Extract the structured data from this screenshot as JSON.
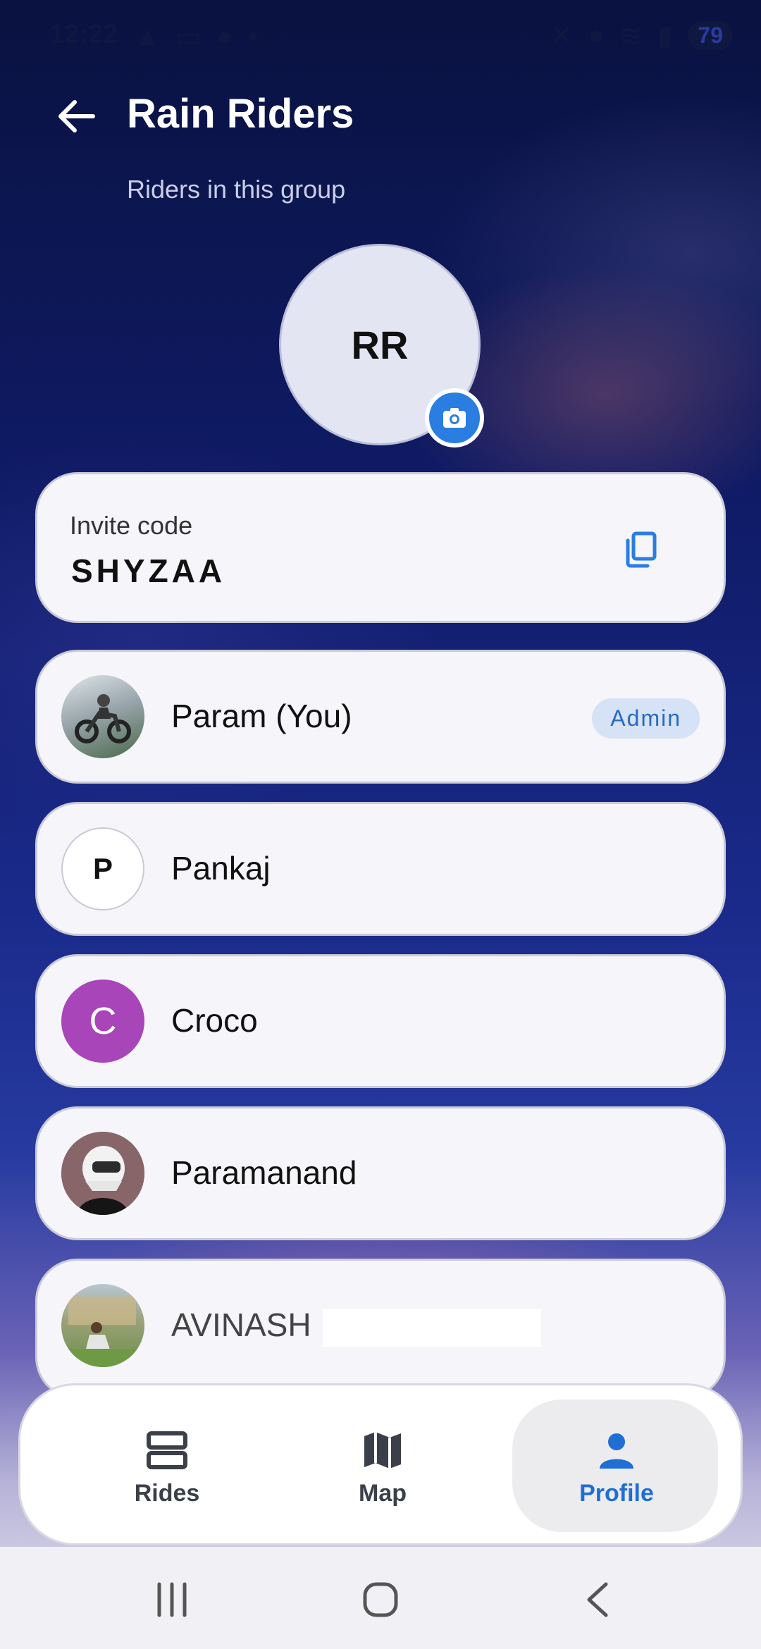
{
  "status_bar": {
    "time": "12:22",
    "battery": "79"
  },
  "header": {
    "title": "Rain Riders",
    "subtitle": "Riders in this group"
  },
  "group": {
    "initials": "RR"
  },
  "invite": {
    "label": "Invite code",
    "code": "SHYZAA"
  },
  "members": [
    {
      "name": "Param (You)",
      "badge": "Admin",
      "avatar_type": "photo",
      "avatar_desc": "motorbike-rider-photo"
    },
    {
      "name": "Pankaj",
      "avatar_type": "initial",
      "initial": "P",
      "avatar_color": "#ffffff"
    },
    {
      "name": "Croco",
      "avatar_type": "initial",
      "initial": "C",
      "avatar_color": "#a845b8"
    },
    {
      "name": "Paramanand",
      "avatar_type": "photo",
      "avatar_desc": "helmet-avatar"
    },
    {
      "name": "AVINASH",
      "avatar_type": "photo",
      "avatar_desc": "person-outdoor-photo"
    }
  ],
  "bottom_nav": {
    "items": [
      {
        "label": "Rides",
        "icon": "rides-icon",
        "active": false
      },
      {
        "label": "Map",
        "icon": "map-icon",
        "active": false
      },
      {
        "label": "Profile",
        "icon": "profile-icon",
        "active": true
      }
    ]
  },
  "colors": {
    "accent": "#2a7de1",
    "active_nav": "#1f6ed4",
    "admin_badge_bg": "#d6e2f5"
  }
}
